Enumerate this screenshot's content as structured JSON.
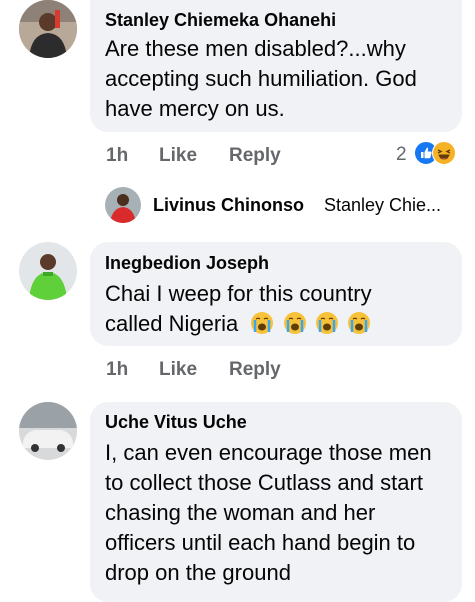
{
  "comments": [
    {
      "author": "Stanley Chiemeka Ohanehi",
      "text": "Are these men disabled?...why accepting such humiliation. God have mercy on us.",
      "time": "1h",
      "like": "Like",
      "reply": "Reply",
      "reaction_count": "2",
      "reaction_icons": [
        "like-icon",
        "haha-icon"
      ]
    },
    {
      "author": "Inegbedion Joseph",
      "text": "Chai I weep for this country called Nigeria",
      "emoji": [
        "loudly-crying-face",
        "loudly-crying-face",
        "loudly-crying-face",
        "loudly-crying-face"
      ],
      "time": "1h",
      "like": "Like",
      "reply": "Reply"
    },
    {
      "author": "Uche Vitus Uche",
      "text": "I, can even encourage those men to collect those Cutlass and start chasing the woman and her officers until each hand begin to drop on the ground"
    }
  ],
  "reply_preview": {
    "author": "Livinus Chinonso",
    "snippet": "Stanley Chie..."
  },
  "colors": {
    "bubble": "#f0f2f5",
    "meta_text": "#65676b",
    "like_blue": "#1877f2",
    "haha_yellow": "#f7b125"
  }
}
